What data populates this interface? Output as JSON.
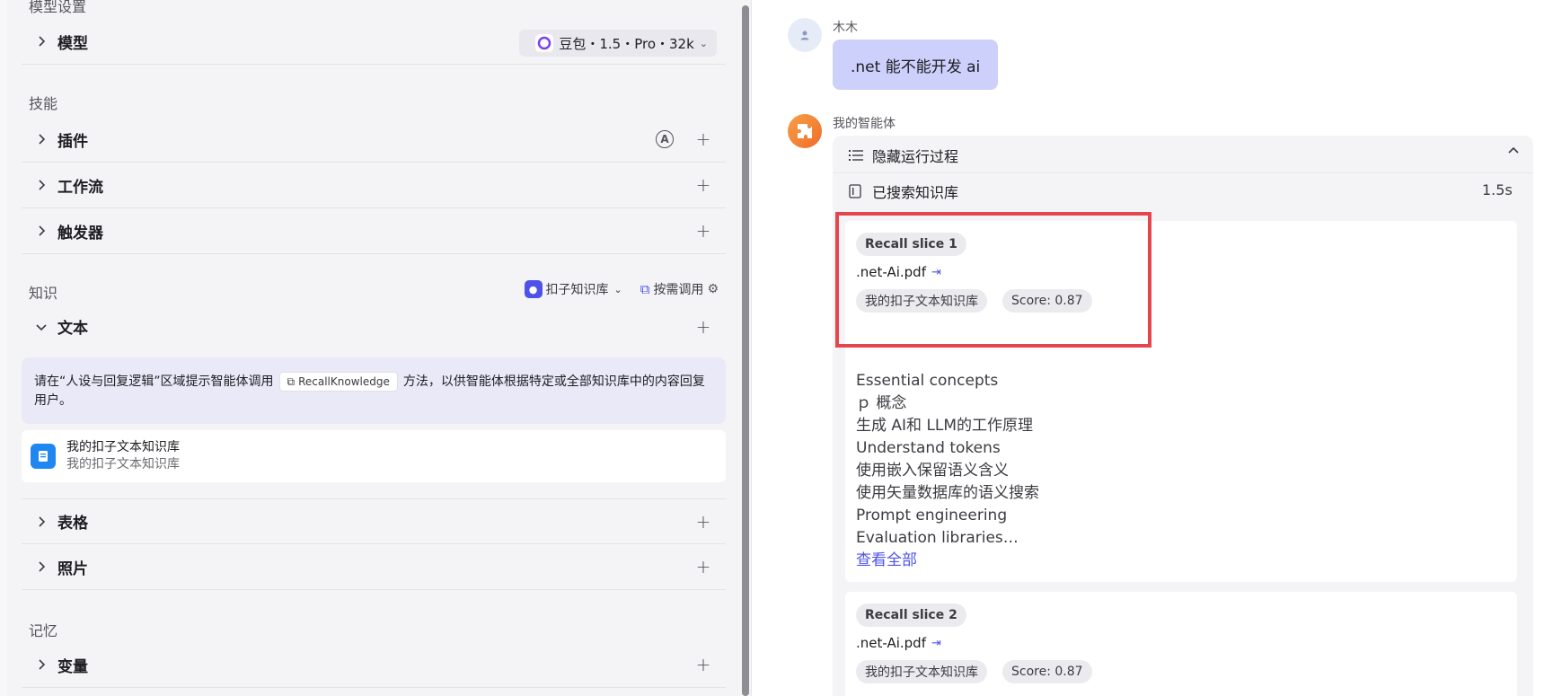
{
  "left": {
    "model_section_title": "模型设置",
    "model_row_label": "模型",
    "model_select_value": "豆包・1.5・Pro・32k",
    "skills_title": "技能",
    "skills": [
      {
        "label": "插件"
      },
      {
        "label": "工作流"
      },
      {
        "label": "触发器"
      }
    ],
    "plugin_badge": "A",
    "knowledge_title": "知识",
    "kb_source": "扣子知识库",
    "kb_mode": "按需调用",
    "text_label": "文本",
    "hint_before": "请在“人设与回复逻辑”区域提示智能体调用",
    "hint_chip": "RecallKnowledge",
    "hint_after": "方法，以供智能体根据特定或全部知识库中的内容回复用户。",
    "kb_item_name": "我的扣子文本知识库",
    "kb_item_desc": "我的扣子文本知识库",
    "table_label": "表格",
    "photo_label": "照片",
    "memory_title": "记忆",
    "variable_label": "变量"
  },
  "chat": {
    "user_name": "木木",
    "user_message": ".net 能不能开发 ai",
    "bot_name": "我的智能体",
    "process_toggle": "隐藏运行过程",
    "search_step": "已搜索知识库",
    "search_time": "1.5s",
    "slices": [
      {
        "title": "Recall slice 1",
        "file": ".net-Ai.pdf",
        "kb": "我的扣子文本知识库",
        "score": "Score: 0.87",
        "lines": [
          "Essential concepts",
          "ｐ 概念",
          "生成 AI和 LLM的工作原理",
          "Understand tokens",
          "使用嵌入保留语义含义",
          "使用矢量数据库的语义搜索",
          "Prompt engineering",
          "Evaluation libraries…"
        ],
        "more": "查看全部"
      },
      {
        "title": "Recall slice 2",
        "file": ".net-Ai.pdf",
        "kb": "我的扣子文本知识库",
        "score": "Score: 0.87"
      }
    ]
  },
  "colors": {
    "accent": "#4d53e8",
    "user_bubble": "#ccd0fb",
    "highlight": "#e5454d",
    "bot_avatar": "#f28a36"
  }
}
